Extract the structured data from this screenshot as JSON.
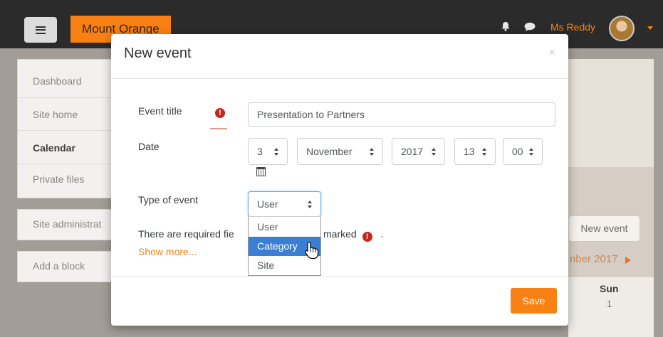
{
  "navbar": {
    "site_name": "Mount Orange",
    "user_name": "Ms Reddy",
    "icons": [
      "menu-icon",
      "bell-icon",
      "chat-icon",
      "avatar",
      "caret-down-icon"
    ]
  },
  "sidebar": {
    "items": [
      {
        "label": "Dashboard"
      },
      {
        "label": "Site home"
      },
      {
        "label": "Calendar"
      },
      {
        "label": "Private files"
      }
    ],
    "admin_label": "Site administrat",
    "add_block_label": "Add a block"
  },
  "calendar_bg": {
    "new_event_label": "New event",
    "month_label": "nber 2017",
    "sun_label": "Sun",
    "sun_first_day": "1"
  },
  "modal": {
    "title": "New event",
    "close_label": "×",
    "event_title_label": "Event title",
    "event_title_value": "Presentation to Partners",
    "date_label": "Date",
    "date": {
      "day": "3",
      "month": "November",
      "year": "2017",
      "hour": "13",
      "minute": "00"
    },
    "type_label": "Type of event",
    "type_value": "User",
    "type_options": [
      "User",
      "Category",
      "Site"
    ],
    "type_highlighted": "Category",
    "required_text_part1": "There are required fie",
    "required_text_part2": "marked",
    "required_text_end": ".",
    "required_icon": "!",
    "show_more_label": "Show more...",
    "save_label": "Save"
  },
  "colors": {
    "brand": "#f98012",
    "required": "#c9251b",
    "highlight": "#3b7fd4"
  }
}
